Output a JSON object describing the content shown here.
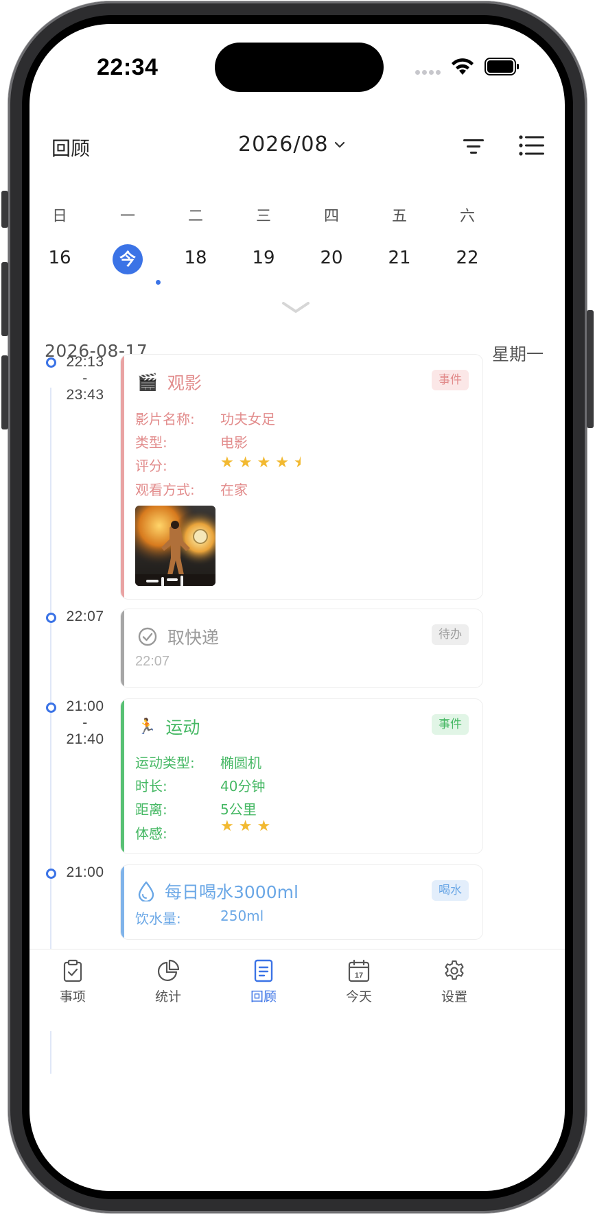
{
  "status_bar": {
    "time": "22:34"
  },
  "header": {
    "title": "回顾",
    "month": "2026/08"
  },
  "week": {
    "day_names": [
      "日",
      "一",
      "二",
      "三",
      "四",
      "五",
      "六"
    ],
    "dates": [
      "16",
      "今",
      "18",
      "19",
      "20",
      "21",
      "22"
    ],
    "today_index": 1
  },
  "date_header": {
    "date": "2026-08-17",
    "weekday": "星期一"
  },
  "entries": [
    {
      "time_start": "22:13",
      "time_sep": "-",
      "time_end": "23:43",
      "icon": "clapperboard-icon",
      "emoji": "🎬",
      "title": "观影",
      "badge": "事件",
      "color": "#e28c8c",
      "fields": [
        {
          "key": "影片名称:",
          "value": "功夫女足"
        },
        {
          "key": "类型:",
          "value": "电影"
        },
        {
          "key": "评分:",
          "rating": 4.5
        },
        {
          "key": "观看方式:",
          "value": "在家"
        }
      ]
    },
    {
      "time_start": "22:07",
      "icon": "check-circle-icon",
      "title": "取快递",
      "badge": "待办",
      "color": "#9b9b9b",
      "sub": "22:07"
    },
    {
      "time_start": "21:00",
      "time_sep": "-",
      "time_end": "21:40",
      "icon": "runner-icon",
      "emoji": "🏃",
      "title": "运动",
      "badge": "事件",
      "color": "#46b864",
      "fields": [
        {
          "key": "运动类型:",
          "value": "椭圆机"
        },
        {
          "key": "时长:",
          "value": "40分钟"
        },
        {
          "key": "距离:",
          "value": "5公里"
        },
        {
          "key": "体感:",
          "rating": 3
        }
      ]
    },
    {
      "time_start": "21:00",
      "icon": "water-drop-icon",
      "title": "每日喝水3000ml",
      "badge": "喝水",
      "color": "#6aa7e6",
      "fields": [
        {
          "key": "饮水量:",
          "value": "250ml"
        }
      ]
    }
  ],
  "tabs": [
    {
      "label": "事项",
      "icon": "clipboard-check-icon"
    },
    {
      "label": "统计",
      "icon": "pie-chart-icon"
    },
    {
      "label": "回顾",
      "icon": "document-icon",
      "active": true
    },
    {
      "label": "今天",
      "icon": "calendar-icon",
      "calendar_day": "17"
    },
    {
      "label": "设置",
      "icon": "gear-icon"
    }
  ]
}
